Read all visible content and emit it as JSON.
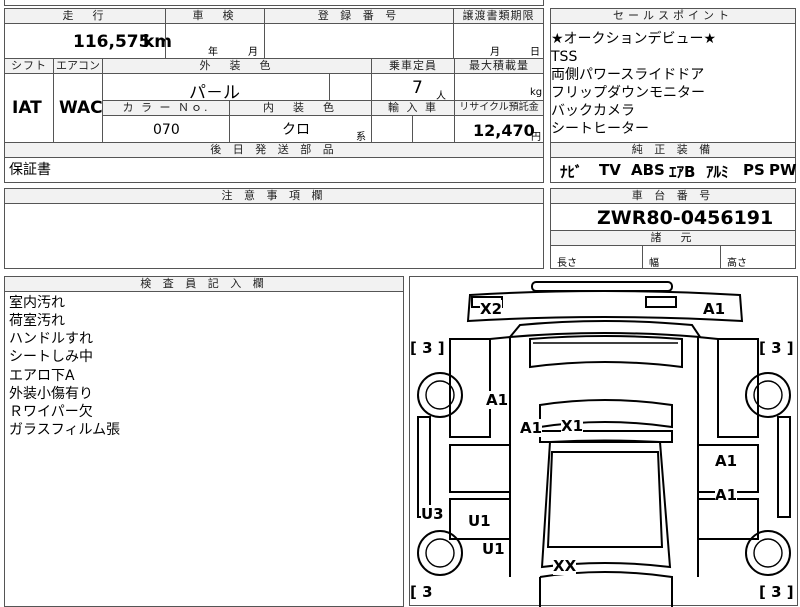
{
  "header": {
    "mileage_label": "走　行",
    "inspection_label": "車　検",
    "registration_label": "登 録 番 号",
    "transfer_label": "譲渡書類期限",
    "sales_label": "セールスポイント"
  },
  "mileage": {
    "value": "116,575",
    "unit": "km"
  },
  "inspection": {
    "year": "年",
    "month": "月"
  },
  "transfer": {
    "month": "月",
    "day": "日"
  },
  "row2_labels": {
    "shift": "シフト",
    "aircon": "エアコン",
    "exterior_color": "外　装　色",
    "capacity": "乗車定員",
    "max_load": "最大積載量"
  },
  "shift": "IAT",
  "aircon": "WAC",
  "exterior_color": "パ－ル",
  "capacity": {
    "value": "7",
    "unit": "人"
  },
  "max_load": {
    "value": "",
    "unit": "kg"
  },
  "row3_labels": {
    "color_no": "カ ラ ー Ｎｏ.",
    "interior_color": "内　装　色",
    "import": "輸 入 車",
    "recycle": "リサイクル預託金"
  },
  "color_no": "070",
  "interior_color": {
    "value": "クロ",
    "suffix": "系"
  },
  "recycle": {
    "value": "12,470",
    "unit": "円"
  },
  "parts": {
    "label": "後 日 発 送 部 品",
    "value": "保証書"
  },
  "sales_points": [
    "★オークションデビュー★",
    "TSS",
    "両側パワースライドドア",
    "フリップダウンモニター",
    "バックカメラ",
    "シートヒーター"
  ],
  "equipment": {
    "label": "純 正 装 備",
    "items": [
      "ﾅﾋﾞ",
      "TV",
      "ABS",
      "ｴｱB",
      "ｱﾙﾐ",
      "PS",
      "PW"
    ]
  },
  "notes": {
    "label": "注 意 事 項 欄",
    "value": ""
  },
  "chassis": {
    "label": "車 台 番 号",
    "value": "ZWR80-0456191"
  },
  "dims": {
    "label": "諸　元",
    "length": "長さ",
    "width": "幅",
    "height": "高さ"
  },
  "inspector": {
    "label": "検 査 員 記 入 欄",
    "notes": [
      "室内汚れ",
      "荷室汚れ",
      "ハンドルすれ",
      "シートしみ中",
      "エアロ下A",
      "外装小傷有り",
      "Ｒワイパー欠",
      "ガラスフィルム張"
    ]
  },
  "diagram_marks": {
    "x2": "X2",
    "a1_top": "A1",
    "tire_tl": "[ 3 ]",
    "tire_tr": "[ 3 ]",
    "a1_left": "A1",
    "a1_mid": "A1",
    "x1": "X1",
    "a1_right1": "A1",
    "a1_right2": "A1",
    "u3": "U3",
    "u1_a": "U1",
    "u1_b": "U1",
    "xx": "XX",
    "tire_bl": "[ 3",
    "tire_br": "[ 3 ]"
  }
}
